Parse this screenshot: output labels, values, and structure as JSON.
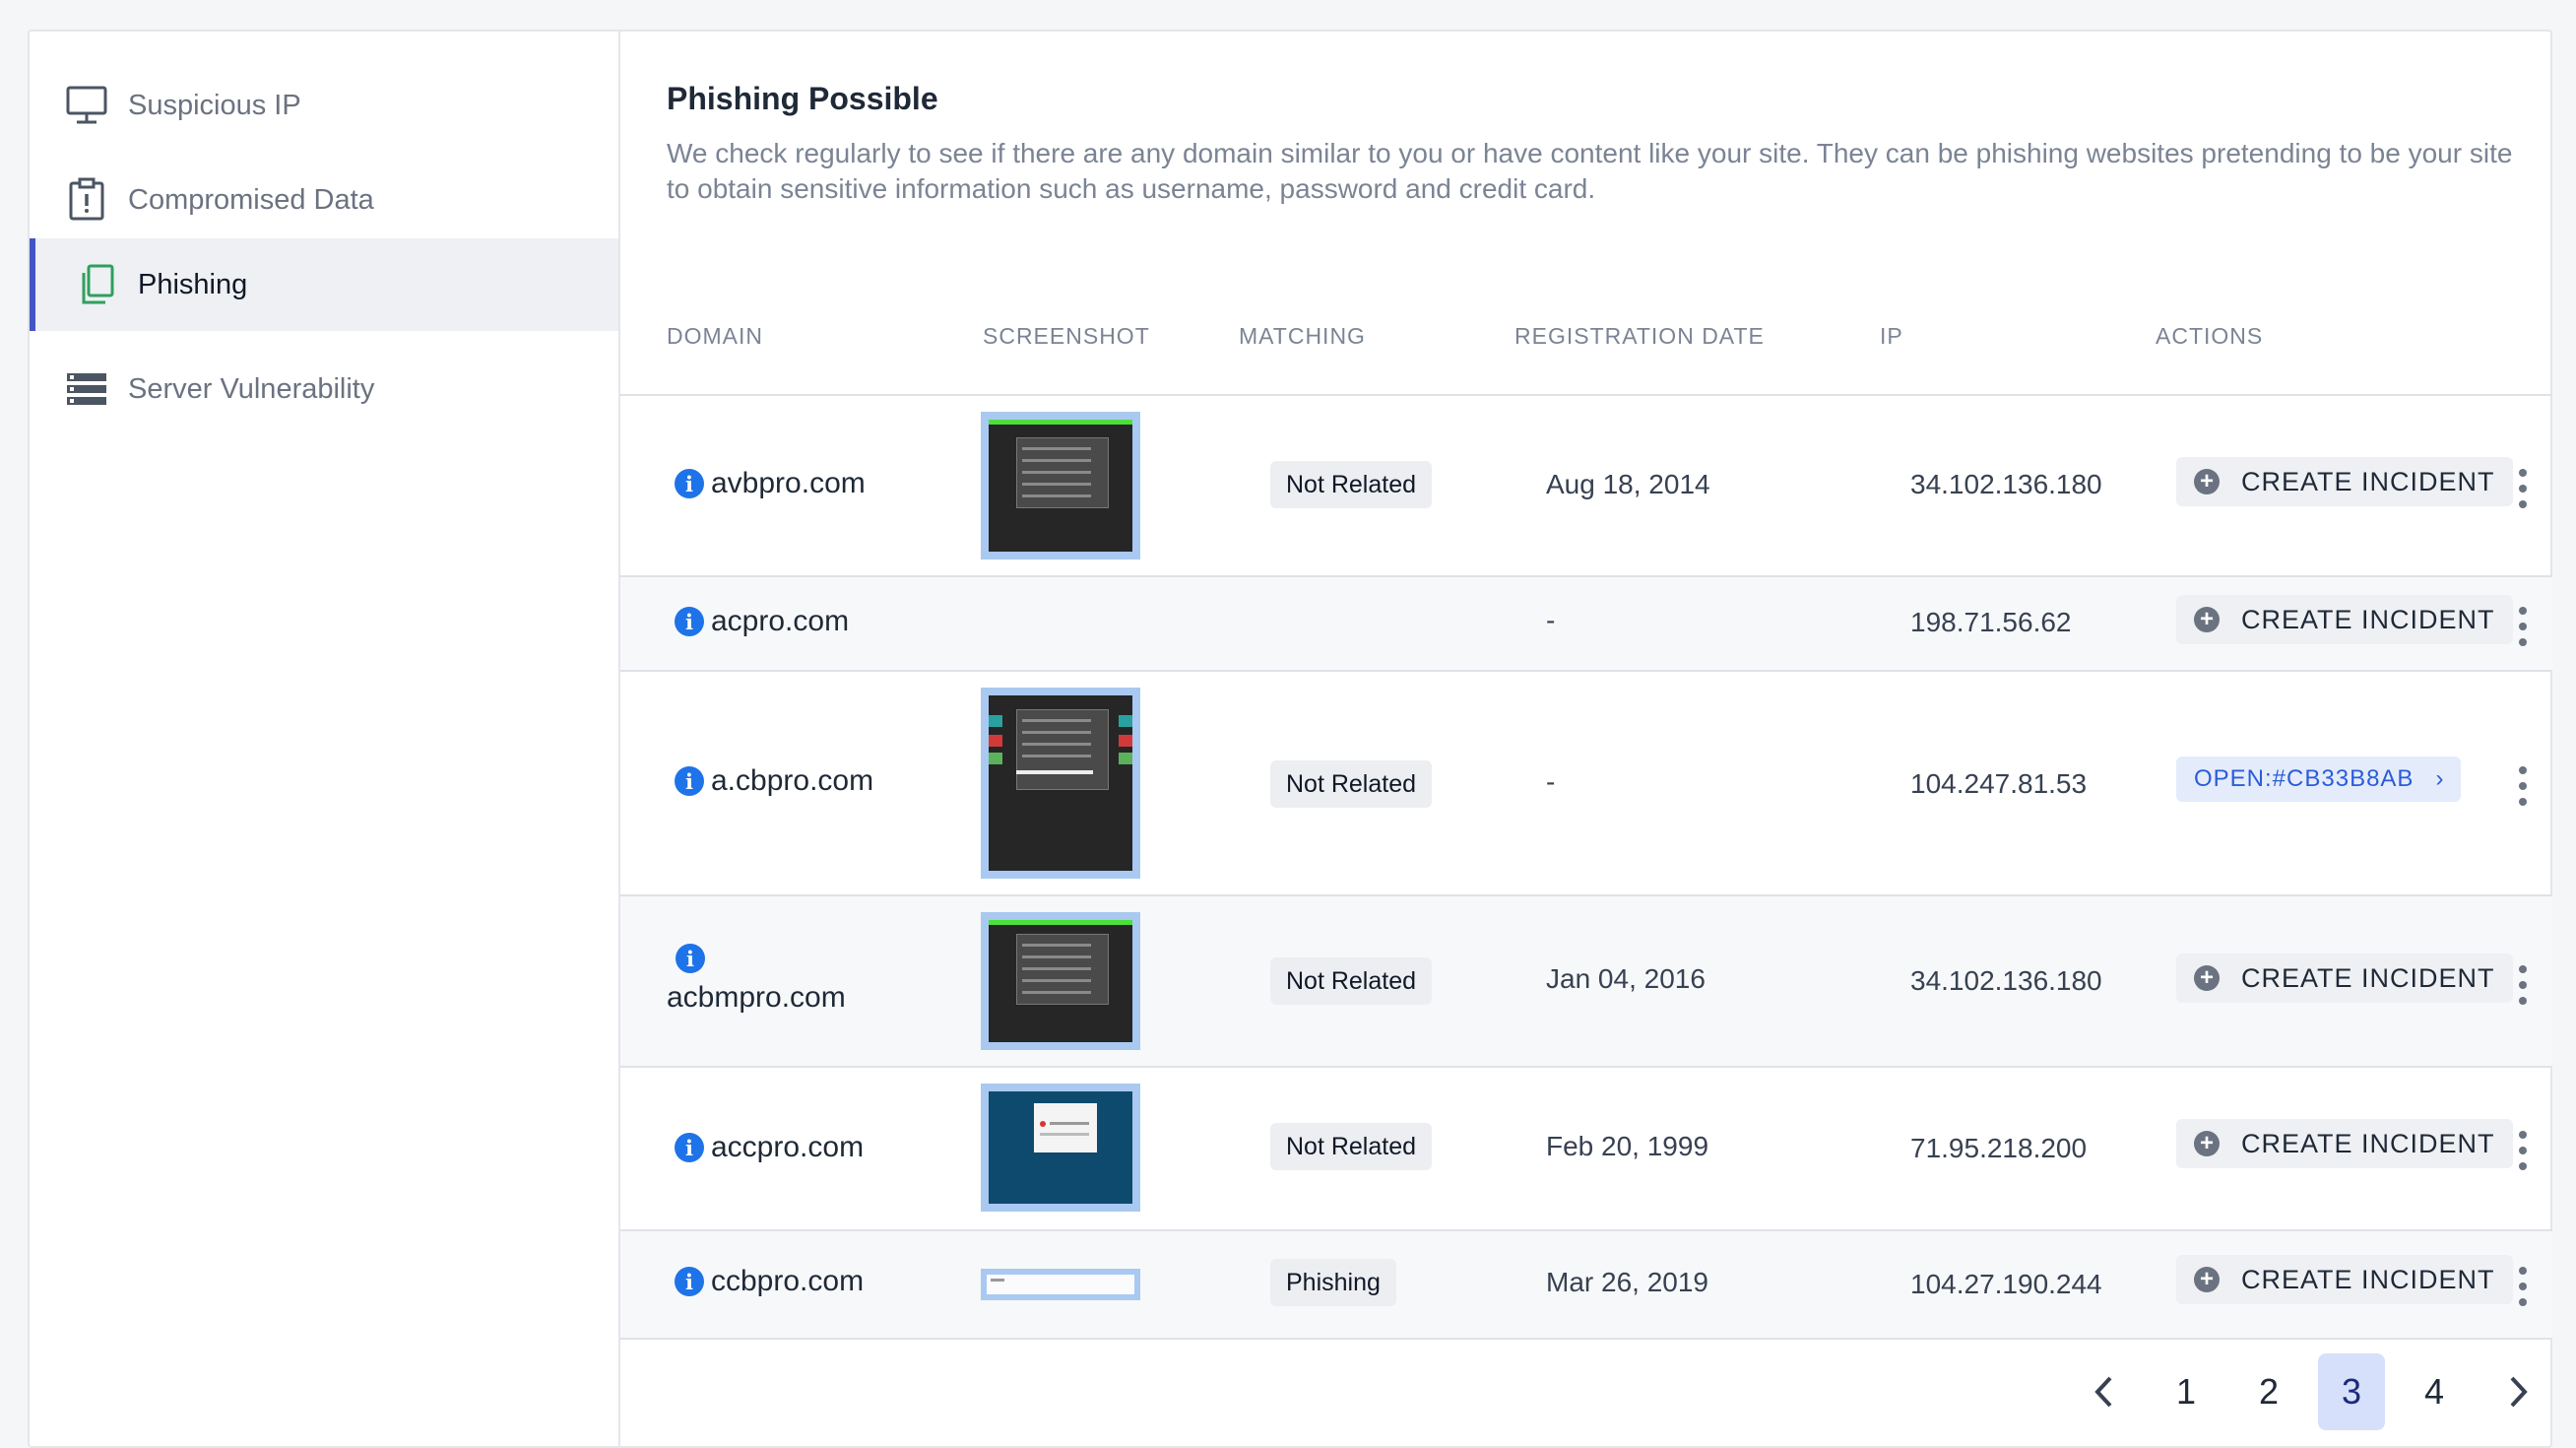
{
  "sidebar": {
    "items": [
      {
        "label": "Suspicious IP",
        "icon": "monitor-icon",
        "active": false
      },
      {
        "label": "Compromised Data",
        "icon": "clipboard-alert-icon",
        "active": false
      },
      {
        "label": "Phishing",
        "icon": "copy-icon",
        "active": true
      },
      {
        "label": "Server Vulnerability",
        "icon": "server-icon",
        "active": false
      }
    ]
  },
  "main": {
    "title": "Phishing Possible",
    "description": "We check regularly to see if there are any domain similar to you or have content like your site. They can be phishing websites pretending to be your site to obtain sensitive information such as username, password and credit card."
  },
  "table": {
    "columns": [
      "DOMAIN",
      "SCREENSHOT",
      "MATCHING",
      "REGISTRATION DATE",
      "IP",
      "ACTIONS"
    ],
    "rows": [
      {
        "domain": "avbpro.com",
        "screenshot": "dark-page-green-bar",
        "matching": "Not Related",
        "registration_date": "Aug 18, 2014",
        "ip": "34.102.136.180",
        "action": "CREATE INCIDENT"
      },
      {
        "domain": "acpro.com",
        "screenshot": "",
        "matching": "",
        "registration_date": "-",
        "ip": "198.71.56.62",
        "action": "CREATE INCIDENT"
      },
      {
        "domain": "a.cbpro.com",
        "screenshot": "dark-page-colored-edges",
        "matching": "Not Related",
        "registration_date": "-",
        "ip": "104.247.81.53",
        "action": "OPEN:#CB33B8AB"
      },
      {
        "domain": "acbmpro.com",
        "screenshot": "dark-page-green-bar",
        "matching": "Not Related",
        "registration_date": "Jan 04, 2016",
        "ip": "34.102.136.180",
        "action": "CREATE INCIDENT"
      },
      {
        "domain": "accpro.com",
        "screenshot": "blue-page-dialog",
        "matching": "Not Related",
        "registration_date": "Feb 20, 1999",
        "ip": "71.95.218.200",
        "action": "CREATE INCIDENT"
      },
      {
        "domain": "ccbpro.com",
        "screenshot": "white-strip",
        "matching": "Phishing",
        "registration_date": "Mar 26, 2019",
        "ip": "104.27.190.244",
        "action": "CREATE INCIDENT"
      }
    ]
  },
  "pagination": {
    "pages": [
      "1",
      "2",
      "3",
      "4"
    ],
    "current": "3"
  },
  "colors": {
    "accent": "#4355c5",
    "info": "#1e73e8",
    "open_link": "#2b5cd9",
    "active_page_bg": "#d6e0fb"
  }
}
